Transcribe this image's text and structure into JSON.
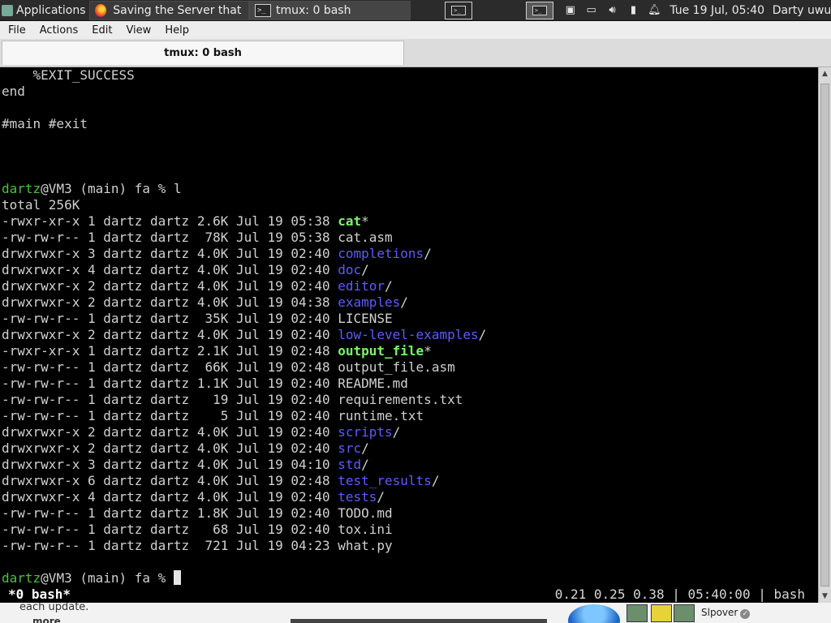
{
  "panel": {
    "applications": "Applications",
    "tasks": [
      {
        "label": "Saving the Server that ...",
        "icon": "firefox-icon"
      },
      {
        "label": "tmux: 0 bash",
        "icon": "terminal-icon"
      }
    ],
    "clock": "Tue 19 Jul, 05:40",
    "user": "Darty uwu"
  },
  "menu": {
    "file": "File",
    "actions": "Actions",
    "edit": "Edit",
    "view": "View",
    "help": "Help"
  },
  "tab": {
    "title": "tmux: 0 bash"
  },
  "terminal": {
    "pre_lines": [
      "    %EXIT_SUCCESS",
      "end",
      "",
      "#main #exit",
      "",
      "",
      ""
    ],
    "prompt": {
      "user": "dartz",
      "rest": "@VM3 (main) fa % ",
      "command": "l"
    },
    "total": "total 256K",
    "listing": [
      {
        "meta": "-rwxr-xr-x 1 dartz dartz 2.6K Jul 19 05:38 ",
        "name": "cat",
        "suffix": "*",
        "type": "exec"
      },
      {
        "meta": "-rw-rw-r-- 1 dartz dartz  78K Jul 19 05:38 ",
        "name": "cat.asm",
        "suffix": "",
        "type": "file"
      },
      {
        "meta": "drwxrwxr-x 3 dartz dartz 4.0K Jul 19 02:40 ",
        "name": "completions",
        "suffix": "/",
        "type": "dir"
      },
      {
        "meta": "drwxrwxr-x 4 dartz dartz 4.0K Jul 19 02:40 ",
        "name": "doc",
        "suffix": "/",
        "type": "dir"
      },
      {
        "meta": "drwxrwxr-x 2 dartz dartz 4.0K Jul 19 02:40 ",
        "name": "editor",
        "suffix": "/",
        "type": "dir"
      },
      {
        "meta": "drwxrwxr-x 2 dartz dartz 4.0K Jul 19 04:38 ",
        "name": "examples",
        "suffix": "/",
        "type": "dir"
      },
      {
        "meta": "-rw-rw-r-- 1 dartz dartz  35K Jul 19 02:40 ",
        "name": "LICENSE",
        "suffix": "",
        "type": "file"
      },
      {
        "meta": "drwxrwxr-x 2 dartz dartz 4.0K Jul 19 02:40 ",
        "name": "low-level-examples",
        "suffix": "/",
        "type": "dir"
      },
      {
        "meta": "-rwxr-xr-x 1 dartz dartz 2.1K Jul 19 02:48 ",
        "name": "output_file",
        "suffix": "*",
        "type": "exec"
      },
      {
        "meta": "-rw-rw-r-- 1 dartz dartz  66K Jul 19 02:48 ",
        "name": "output_file.asm",
        "suffix": "",
        "type": "file"
      },
      {
        "meta": "-rw-rw-r-- 1 dartz dartz 1.1K Jul 19 02:40 ",
        "name": "README.md",
        "suffix": "",
        "type": "file"
      },
      {
        "meta": "-rw-rw-r-- 1 dartz dartz   19 Jul 19 02:40 ",
        "name": "requirements.txt",
        "suffix": "",
        "type": "file"
      },
      {
        "meta": "-rw-rw-r-- 1 dartz dartz    5 Jul 19 02:40 ",
        "name": "runtime.txt",
        "suffix": "",
        "type": "file"
      },
      {
        "meta": "drwxrwxr-x 2 dartz dartz 4.0K Jul 19 02:40 ",
        "name": "scripts",
        "suffix": "/",
        "type": "dir"
      },
      {
        "meta": "drwxrwxr-x 2 dartz dartz 4.0K Jul 19 02:40 ",
        "name": "src",
        "suffix": "/",
        "type": "dir"
      },
      {
        "meta": "drwxrwxr-x 3 dartz dartz 4.0K Jul 19 04:10 ",
        "name": "std",
        "suffix": "/",
        "type": "dir"
      },
      {
        "meta": "drwxrwxr-x 6 dartz dartz 4.0K Jul 19 02:48 ",
        "name": "test_results",
        "suffix": "/",
        "type": "dir"
      },
      {
        "meta": "drwxrwxr-x 4 dartz dartz 4.0K Jul 19 02:40 ",
        "name": "tests",
        "suffix": "/",
        "type": "dir"
      },
      {
        "meta": "-rw-rw-r-- 1 dartz dartz 1.8K Jul 19 02:40 ",
        "name": "TODO.md",
        "suffix": "",
        "type": "file"
      },
      {
        "meta": "-rw-rw-r-- 1 dartz dartz   68 Jul 19 02:40 ",
        "name": "tox.ini",
        "suffix": "",
        "type": "file"
      },
      {
        "meta": "-rw-rw-r-- 1 dartz dartz  721 Jul 19 04:23 ",
        "name": "what.py",
        "suffix": "",
        "type": "file"
      }
    ],
    "final_prompt": {
      "user": "dartz",
      "rest": "@VM3 (main) fa % "
    }
  },
  "tmux_status": {
    "window": "*0 bash*",
    "right": "0.21 0.25 0.38 | 05:40:00 | bash"
  },
  "bottom": {
    "note": "each update.",
    "more": "more",
    "user": "Slpover"
  },
  "colors": {
    "prompt_user": "#4fbf3f",
    "directory": "#5c5cff",
    "executable": "#7af56a",
    "terminal_bg": "#000000"
  }
}
